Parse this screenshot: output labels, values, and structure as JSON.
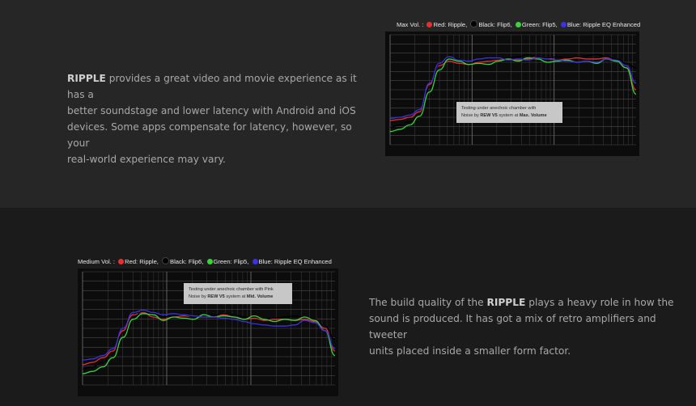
{
  "section1": {
    "para": {
      "brand": "RIPPLE",
      "lines": [
        " provides a great video and movie experience as it has a",
        "better soundstage and lower latency with Android and iOS",
        "devices. Some apps compensate for latency, however, so your",
        "real-world experience may vary."
      ]
    }
  },
  "section2": {
    "para": {
      "pre": "The build quality of the ",
      "brand": "RIPPLE",
      "post": " plays a heavy role in how the",
      "lines": [
        "sound is produced. It has got a mix of retro amplifiers and tweeter",
        "units placed inside a smaller form factor."
      ]
    }
  },
  "legend_items": [
    {
      "label": "Red: Ripple,",
      "color": "#e53030"
    },
    {
      "label": "Black: Flip6,",
      "color": "#000000"
    },
    {
      "label": "Green: Flip5,",
      "color": "#39d43c"
    },
    {
      "label": "Blue: Ripple EQ Enhanced",
      "color": "#3a33e0"
    }
  ],
  "chart_data": [
    {
      "type": "line",
      "legend_title": "Max Vol. :",
      "note": {
        "line1": "Testing under anechoic chamber with",
        "pre2": "Noise by ",
        "bold2a": "REW V5",
        "mid2": " system at ",
        "bold2b": "Max. Volume"
      },
      "series": [
        {
          "name": "Red: Ripple",
          "color": "#e53030",
          "values": [
            22,
            23,
            25,
            30,
            55,
            72,
            76,
            74,
            73,
            75,
            76,
            77,
            78,
            77,
            78,
            80,
            79,
            77,
            78,
            79,
            78,
            78,
            79,
            76,
            70,
            50
          ]
        },
        {
          "name": "Black: Flip6",
          "color": "#000000",
          "values": [
            16,
            18,
            21,
            28,
            52,
            73,
            79,
            78,
            74,
            76,
            77,
            78,
            79,
            80,
            82,
            80,
            79,
            80,
            79,
            80,
            81,
            82,
            80,
            78,
            74,
            70
          ]
        },
        {
          "name": "Green: Flip5",
          "color": "#39d43c",
          "values": [
            12,
            14,
            18,
            26,
            48,
            68,
            78,
            76,
            73,
            74,
            73,
            76,
            78,
            76,
            79,
            78,
            75,
            76,
            77,
            75,
            76,
            74,
            78,
            76,
            70,
            46
          ]
        },
        {
          "name": "Blue: Ripple EQ Enhanced",
          "color": "#3a33e0",
          "values": [
            24,
            25,
            27,
            32,
            56,
            74,
            80,
            77,
            76,
            78,
            79,
            79,
            77,
            78,
            77,
            79,
            78,
            77,
            76,
            75,
            76,
            75,
            78,
            77,
            72,
            56
          ]
        }
      ]
    },
    {
      "type": "line",
      "legend_title": "Medium Vol. :",
      "note": {
        "line1": "Testing under anechoic chamber with Pink",
        "pre2": "Noise by ",
        "bold2a": "REW V5",
        "mid2": " system at ",
        "bold2b": "Mid. Volume"
      },
      "series": [
        {
          "name": "Red: Ripple",
          "color": "#e53030",
          "values": [
            18,
            20,
            24,
            30,
            48,
            62,
            64,
            60,
            58,
            60,
            61,
            60,
            60,
            60,
            62,
            60,
            58,
            59,
            57,
            58,
            58,
            57,
            58,
            56,
            50,
            30
          ]
        },
        {
          "name": "Black: Flip6",
          "color": "#000000",
          "values": [
            14,
            16,
            20,
            28,
            46,
            60,
            65,
            63,
            60,
            61,
            62,
            60,
            61,
            62,
            63,
            62,
            60,
            60,
            58,
            59,
            60,
            61,
            60,
            58,
            52,
            40
          ]
        },
        {
          "name": "Green: Flip5",
          "color": "#39d43c",
          "values": [
            10,
            12,
            16,
            24,
            42,
            58,
            63,
            62,
            57,
            60,
            59,
            58,
            62,
            60,
            61,
            60,
            58,
            61,
            58,
            56,
            58,
            57,
            60,
            57,
            48,
            26
          ]
        },
        {
          "name": "Blue: Ripple EQ Enhanced",
          "color": "#3a33e0",
          "values": [
            22,
            23,
            26,
            32,
            50,
            64,
            66,
            64,
            62,
            63,
            62,
            61,
            60,
            60,
            59,
            58,
            56,
            54,
            53,
            52,
            52,
            53,
            57,
            55,
            48,
            32
          ]
        }
      ]
    }
  ]
}
